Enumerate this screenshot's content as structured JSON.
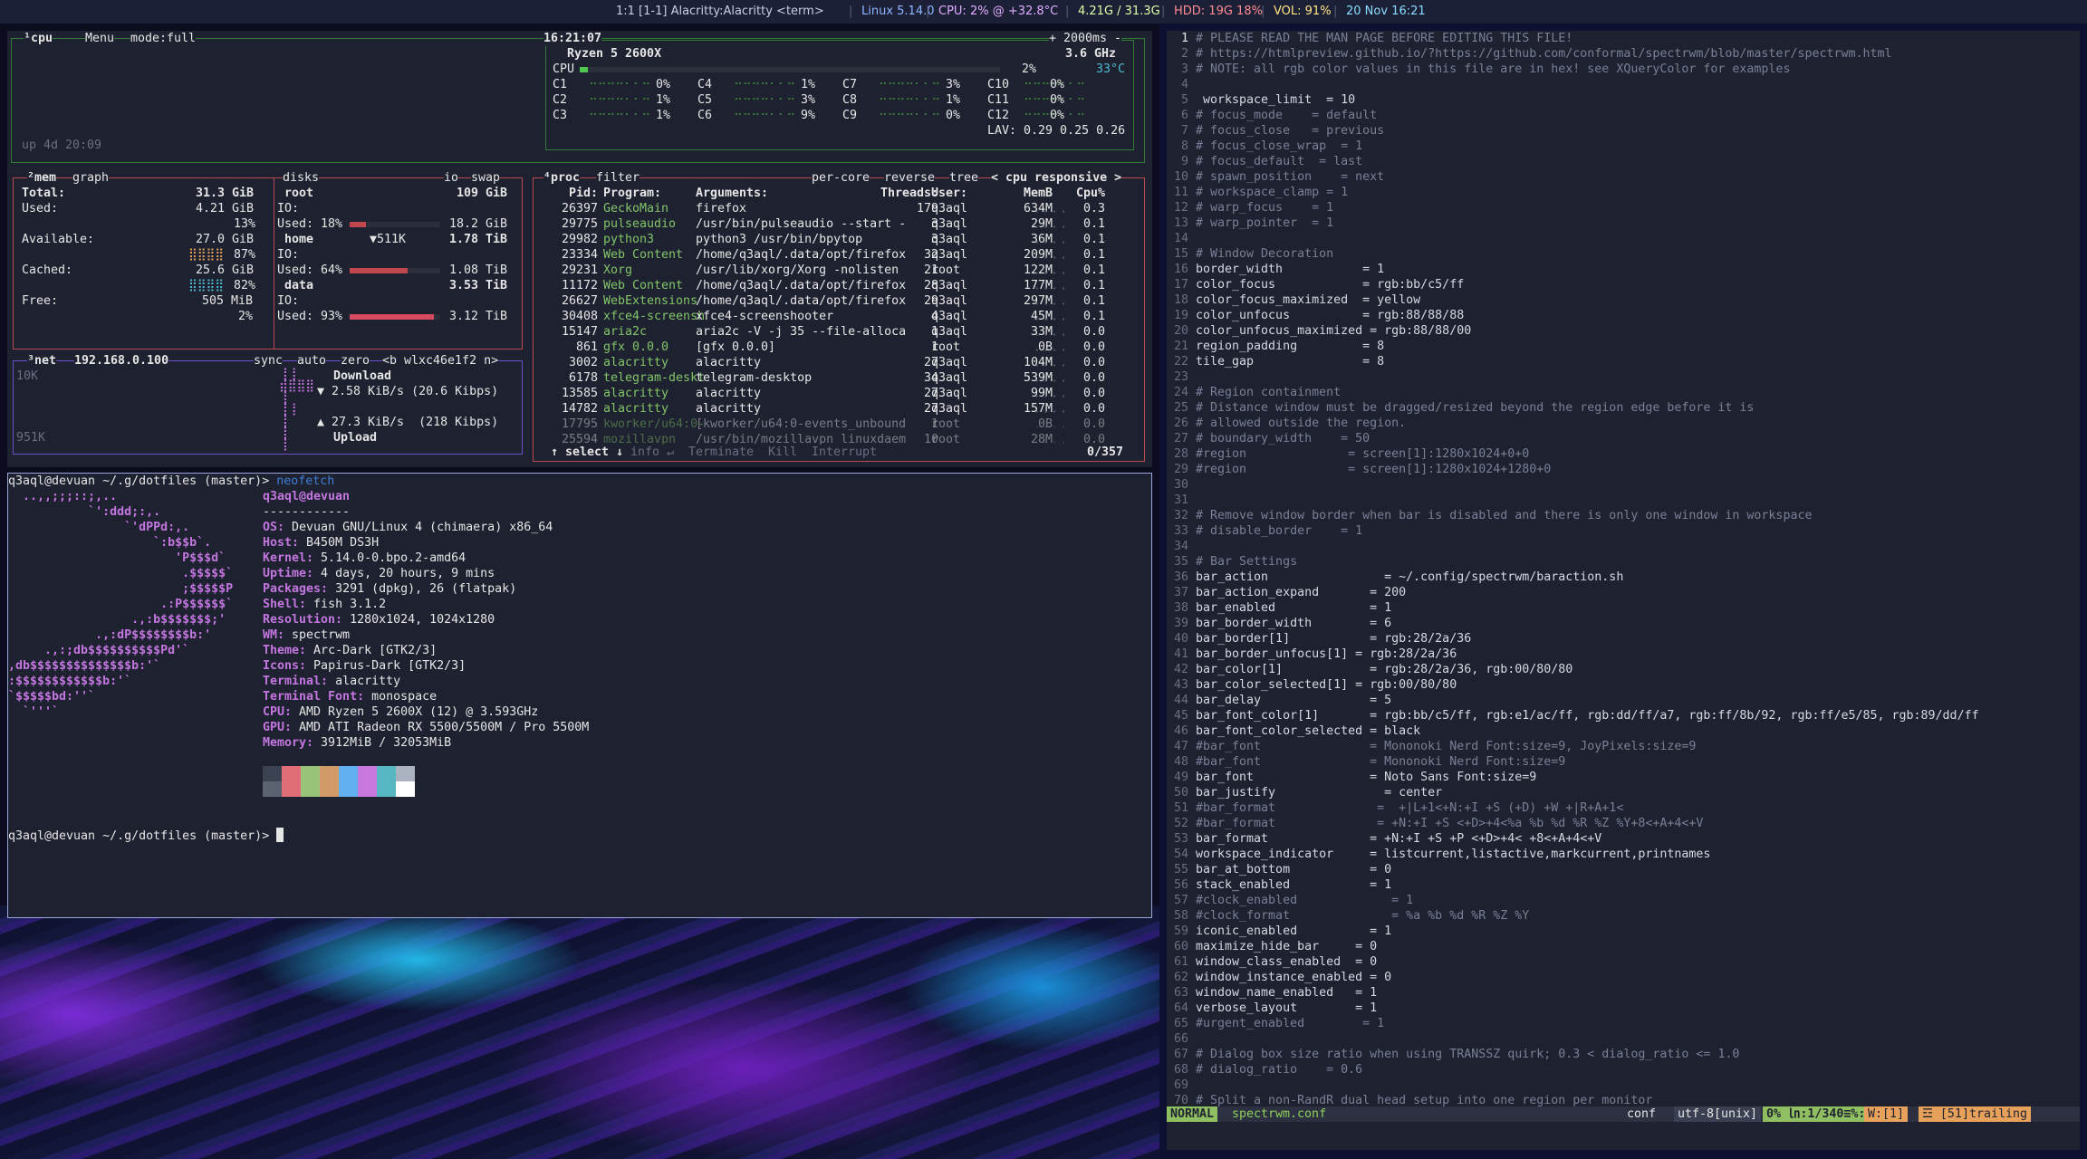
{
  "statusbar": {
    "ws": "1:1 [1-1] Alacritty:Alacritty <term>",
    "kernel": "Linux 5.14.0",
    "cpu": "CPU: 2% @ +32.8°C",
    "mem": "4.21G / 31.3G",
    "hdd": "HDD: 19G 18%",
    "vol": "VOL: 91%",
    "date": "20 Nov 16:21"
  },
  "btop": {
    "cpu_box": {
      "title": "¹cpu",
      "menu": "Menu",
      "mode": "mode:full",
      "time": "16:21:07",
      "interval": "+ 2000ms -",
      "uptime": "up 4d 20:09",
      "model": "Ryzen 5 2600X",
      "freq": "3.6 GHz",
      "total_label": "CPU",
      "total_pct": "2%",
      "total_temp": "33°C",
      "total_fill": 0.02,
      "cores": [
        {
          "n": "C1",
          "p": "0%"
        },
        {
          "n": "C2",
          "p": "1%"
        },
        {
          "n": "C3",
          "p": "1%"
        },
        {
          "n": "C4",
          "p": "1%"
        },
        {
          "n": "C5",
          "p": "3%"
        },
        {
          "n": "C6",
          "p": "9%"
        },
        {
          "n": "C7",
          "p": "3%"
        },
        {
          "n": "C8",
          "p": "1%"
        },
        {
          "n": "C9",
          "p": "0%"
        },
        {
          "n": "C10",
          "p": "0%"
        },
        {
          "n": "C11",
          "p": "0%"
        },
        {
          "n": "C12",
          "p": "0%"
        }
      ],
      "lav": "LAV: 0.29 0.25 0.26"
    },
    "mem_box": {
      "title": "²mem",
      "graph": "graph",
      "total_l": "Total:",
      "total_v": "31.3 GiB",
      "used_l": "Used:",
      "used_v": "4.21 GiB",
      "used_p": "13%",
      "avail_l": "Available:",
      "avail_v": "27.0 GiB",
      "avail_p": "87%",
      "cached_l": "Cached:",
      "cached_v": "25.6 GiB",
      "cached_p": "82%",
      "free_l": "Free:",
      "free_v": "505 MiB",
      "free_p": "2%"
    },
    "disks_box": {
      "title": "disks",
      "io": "io",
      "swap": "swap",
      "root": "root",
      "root_size": "109 GiB",
      "io_l": "IO:",
      "used_root": "Used: 18%",
      "used_root_v": "18.2 GiB",
      "root_fill": 0.18,
      "home": "home",
      "home_io": "▼511K",
      "home_size": "1.78 TiB",
      "used_home": "Used: 64%",
      "used_home_v": "1.08 TiB",
      "home_fill": 0.64,
      "data": "data",
      "data_size": "3.53 TiB",
      "used_data": "Used: 93%",
      "used_data_v": "3.12 TiB",
      "data_fill": 0.93
    },
    "net_box": {
      "title": "³net",
      "ip": "192.168.0.100",
      "sync": "sync",
      "auto": "auto",
      "zero": "zero",
      "iface": "<b wlxc46e1f2 n>",
      "top_scale": "10K",
      "bot_scale": "951K",
      "download": "Download",
      "down_rate": "▼ 2.58 KiB/s (20.6 Kibps)",
      "up_rate": "▲ 27.3 KiB/s  (218 Kibps)",
      "upload": "Upload"
    },
    "proc_box": {
      "title": "⁴proc",
      "filter": "filter",
      "percore": "per-core",
      "reverse": "reverse",
      "tree": "tree",
      "sort": "< cpu responsive >",
      "headers": [
        "Pid:",
        "Program:",
        "Arguments:",
        "Threads:",
        "User:",
        "MemB",
        "Cpu%"
      ],
      "rows": [
        [
          "26397",
          "GeckoMain",
          "firefox",
          "179",
          "q3aql",
          "634M",
          "0.3"
        ],
        [
          "29775",
          "pulseaudio",
          "/usr/bin/pulseaudio --start -",
          "3",
          "q3aql",
          "29M",
          "0.1"
        ],
        [
          "29982",
          "python3",
          "python3 /usr/bin/bpytop",
          "3",
          "q3aql",
          "36M",
          "0.1"
        ],
        [
          "23334",
          "Web Content",
          "/home/q3aql/.data/opt/firefox",
          "32",
          "q3aql",
          "209M",
          "0.1"
        ],
        [
          "29231",
          "Xorg",
          "/usr/lib/xorg/Xorg -nolisten",
          "21",
          "root",
          "122M",
          "0.1"
        ],
        [
          "11172",
          "Web Content",
          "/home/q3aql/.data/opt/firefox",
          "28",
          "q3aql",
          "177M",
          "0.1"
        ],
        [
          "26627",
          "WebExtensions",
          "/home/q3aql/.data/opt/firefox",
          "29",
          "q3aql",
          "297M",
          "0.1"
        ],
        [
          "30408",
          "xfce4-screensh",
          "xfce4-screenshooter",
          "4",
          "q3aql",
          "45M",
          "0.1"
        ],
        [
          "15147",
          "aria2c",
          "aria2c -V -j 35 --file-alloca",
          "1",
          "q3aql",
          "33M",
          "0.0"
        ],
        [
          "861",
          "gfx 0.0.0",
          "[gfx 0.0.0]",
          "1",
          "root",
          "0B",
          "0.0"
        ],
        [
          "3002",
          "alacritty",
          "alacritty",
          "27",
          "q3aql",
          "104M",
          "0.0"
        ],
        [
          "6178",
          "telegram-deskt",
          "telegram-desktop",
          "34",
          "q3aql",
          "539M",
          "0.0"
        ],
        [
          "13585",
          "alacritty",
          "alacritty",
          "27",
          "q3aql",
          "99M",
          "0.0"
        ],
        [
          "14782",
          "alacritty",
          "alacritty",
          "27",
          "q3aql",
          "157M",
          "0.0"
        ],
        [
          "17795",
          "kworker/u64:0-",
          "[kworker/u64:0-events_unbound",
          "1",
          "root",
          "0B",
          "0.0"
        ],
        [
          "25594",
          "mozillavpn",
          "/usr/bin/mozillavpn linuxdaem",
          "10",
          "root",
          "28M",
          "0.0"
        ]
      ],
      "footer_select": "↑ select ↓",
      "footer_info": "info ↵",
      "footer_term": "Terminate",
      "footer_kill": "Kill",
      "footer_int": "Interrupt",
      "count": "0/357"
    }
  },
  "terminal": {
    "prompt1": "q3aql@devuan ~/.g/dotfiles (master)> ",
    "cmd": "neofetch",
    "userhost": "q3aql@devuan",
    "sep": "------------",
    "logo": [
      "  ..,,;;;::;,..",
      "           `':ddd;:,.",
      "                `'dPPd:,.",
      "                    `:b$$b`.",
      "                       'P$$$d`",
      "                        .$$$$$`",
      "                        ;$$$$$P",
      "                     .:P$$$$$$`",
      "                 .,:b$$$$$$$;'",
      "            .,:dP$$$$$$$$b:'",
      "     .,:;db$$$$$$$$$$Pd'`",
      ",db$$$$$$$$$$$$$$b:'`",
      ":$$$$$$$$$$$$b:'`",
      "`$$$$$bd:''`",
      "  `'''`"
    ],
    "info": [
      {
        "k": "OS",
        "v": "Devuan GNU/Linux 4 (chimaera) x86_64"
      },
      {
        "k": "Host",
        "v": "B450M DS3H"
      },
      {
        "k": "Kernel",
        "v": "5.14.0-0.bpo.2-amd64"
      },
      {
        "k": "Uptime",
        "v": "4 days, 20 hours, 9 mins"
      },
      {
        "k": "Packages",
        "v": "3291 (dpkg), 26 (flatpak)"
      },
      {
        "k": "Shell",
        "v": "fish 3.1.2"
      },
      {
        "k": "Resolution",
        "v": "1280x1024, 1024x1280"
      },
      {
        "k": "WM",
        "v": "spectrwm"
      },
      {
        "k": "Theme",
        "v": "Arc-Dark [GTK2/3]"
      },
      {
        "k": "Icons",
        "v": "Papirus-Dark [GTK2/3]"
      },
      {
        "k": "Terminal",
        "v": "alacritty"
      },
      {
        "k": "Terminal Font",
        "v": "monospace"
      },
      {
        "k": "CPU",
        "v": "AMD Ryzen 5 2600X (12) @ 3.593GHz"
      },
      {
        "k": "GPU",
        "v": "AMD ATI Radeon RX 5500/5500M / Pro 5500M"
      },
      {
        "k": "Memory",
        "v": "3912MiB / 32053MiB"
      }
    ],
    "colors": [
      "#3b4252",
      "#e06c75",
      "#98c379",
      "#d19a66",
      "#61afef",
      "#c678dd",
      "#56b6c2",
      "#abb2bf",
      "#5c6370",
      "#e06c75",
      "#98c379",
      "#d19a66",
      "#61afef",
      "#c678dd",
      "#56b6c2",
      "#ffffff"
    ],
    "prompt2": "q3aql@devuan ~/.g/dotfiles (master)> "
  },
  "editor": {
    "lines": [
      "# PLEASE READ THE MAN PAGE BEFORE EDITING THIS FILE!",
      "# https://htmlpreview.github.io/?https://github.com/conformal/spectrwm/blob/master/spectrwm.html",
      "# NOTE: all rgb color values in this file are in hex! see XQueryColor for examples",
      "",
      " workspace_limit  = 10",
      "# focus_mode    = default",
      "# focus_close   = previous",
      "# focus_close_wrap  = 1",
      "# focus_default  = last",
      "# spawn_position    = next",
      "# workspace_clamp = 1",
      "# warp_focus    = 1",
      "# warp_pointer  = 1",
      "",
      "# Window Decoration",
      "border_width           = 1",
      "color_focus            = rgb:bb/c5/ff",
      "color_focus_maximized  = yellow",
      "color_unfocus          = rgb:88/88/88",
      "color_unfocus_maximized = rgb:88/88/00",
      "region_padding         = 8",
      "tile_gap               = 8",
      "",
      "# Region containment",
      "# Distance window must be dragged/resized beyond the region edge before it is",
      "# allowed outside the region.",
      "# boundary_width    = 50",
      "#region              = screen[1]:1280x1024+0+0",
      "#region              = screen[1]:1280x1024+1280+0",
      "",
      "",
      "# Remove window border when bar is disabled and there is only one window in workspace",
      "# disable_border    = 1",
      "",
      "# Bar Settings",
      "bar_action                = ~/.config/spectrwm/baraction.sh",
      "bar_action_expand       = 200",
      "bar_enabled             = 1",
      "bar_border_width        = 6",
      "bar_border[1]           = rgb:28/2a/36",
      "bar_border_unfocus[1] = rgb:28/2a/36",
      "bar_color[1]            = rgb:28/2a/36, rgb:00/80/80",
      "bar_color_selected[1] = rgb:00/80/80",
      "bar_delay               = 5",
      "bar_font_color[1]       = rgb:bb/c5/ff, rgb:e1/ac/ff, rgb:dd/ff/a7, rgb:ff/8b/92, rgb:ff/e5/85, rgb:89/dd/ff",
      "bar_font_color_selected = black",
      "#bar_font               = Mononoki Nerd Font:size=9, JoyPixels:size=9",
      "#bar_font               = Mononoki Nerd Font:size=9",
      "bar_font                = Noto Sans Font:size=9",
      "bar_justify               = center",
      "#bar_format              =  +|L+1<+N:+I +S (+D) +W +|R+A+1<",
      "#bar_format              = +N:+I +S <+D>+4<%a %b %d %R %Z %Y+8<+A+4<+V",
      "bar_format              = +N:+I +S +P <+D>+4< +8<+A+4<+V",
      "workspace_indicator     = listcurrent,listactive,markcurrent,printnames",
      "bar_at_bottom           = 0",
      "stack_enabled           = 1",
      "#clock_enabled             = 1",
      "#clock_format              = %a %b %d %R %Z %Y",
      "iconic_enabled          = 1",
      "maximize_hide_bar     = 0",
      "window_class_enabled  = 0",
      "window_instance_enabled = 0",
      "window_name_enabled   = 1",
      "verbose_layout        = 1",
      "#urgent_enabled        = 1",
      "",
      "# Dialog box size ratio when using TRANSSZ quirk; 0.3 < dialog_ratio <= 1.0",
      "# dialog_ratio    = 0.6",
      "",
      "# Split a non-RandR dual head setup into one region per monitor"
    ],
    "mode": "NORMAL",
    "file": "spectrwm.conf",
    "ft": "conf",
    "enc": "utf-8[unix]",
    "pos": "0% ㏑:1/340≡%:1",
    "w": "W:[1]",
    "trail": "☲ [51]trailing"
  }
}
